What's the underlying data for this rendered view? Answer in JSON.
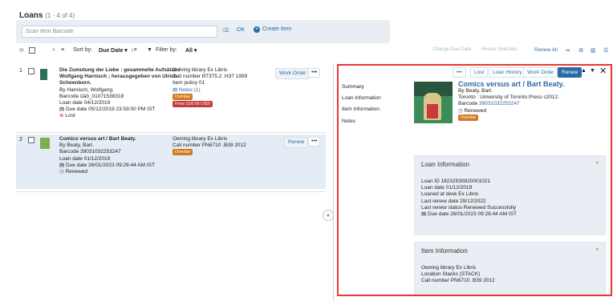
{
  "header": {
    "title": "Loans",
    "count": "(1 - 4 of 4)"
  },
  "scan": {
    "placeholder": "Scan Item Barcode",
    "ok": "OK",
    "create_item": "Create Item"
  },
  "toolbar": {
    "sort_label": "Sort by:",
    "sort_value": "Due Date",
    "filter_label": "Filter by:",
    "filter_value": "All",
    "change_due_date": "Change Due Date",
    "renew_selected": "Renew Selected",
    "renew_all": "Renew All"
  },
  "loans": [
    {
      "num": "1",
      "title": "Die Zumutung der Liebe : gesammelte Aufsätze / Wolfgang Harnisch ; herausgegeben von Ulrich Schoenborn.",
      "by": "By Harnisch, Wolfgang.",
      "barcode": "Barcode üäö_01071538318",
      "loan_date": "Loan date 04/12/2019",
      "due_date": "Due date 05/12/2019 23:59:00 PM IST",
      "status": "Lost",
      "owning_library": "Owning library Ex Libris",
      "call_number": "Call number BT375.2 .H37 1999",
      "item_policy": "Item policy 01",
      "notes": "Notes (1)",
      "badge_overdue": "Overdue",
      "badge_fines": "Fines (100.00 USD)",
      "action": "Work Order",
      "more": "•••"
    },
    {
      "num": "2",
      "title": "Comics versus art / Bart Beaty.",
      "by": "By Beaty, Bart.",
      "barcode": "Barcode 39031032253247",
      "loan_date": "Loan date 01/12/2019",
      "due_date": "Due date 26/01/2023 09:26:44 AM IST",
      "status": "Renewed",
      "owning_library": "Owning library Ex Libris",
      "call_number": "Call number PN6710 .B39 2012",
      "badge_overdue": "Overdue",
      "action": "Renew",
      "more": "•••"
    }
  ],
  "panel": {
    "more": "•••",
    "lost": "Lost",
    "loan_history": "Loan History",
    "work_order": "Work Order",
    "renew": "Renew",
    "nav": [
      "Summary",
      "Loan Information",
      "Item Information",
      "Notes"
    ],
    "title": "Comics versus art / Bart Beaty.",
    "by": "By Beaty, Bart.",
    "publisher": "Toronto : University of Toronto Press c2012.",
    "barcode_label": "Barcode",
    "barcode_value": "39031032253247",
    "status": "Renewed",
    "badge": "Overdue",
    "loan_info": {
      "heading": "Loan Information",
      "loan_id": "Loan ID 18232930820001021",
      "loan_date": "Loan date 01/12/2019",
      "loaned_at": "Loaned at desk Ex Libris",
      "last_renew": "Last renew date 29/12/2022",
      "renew_status": "Last renew status Renewed Successfully",
      "due_date": "Due date 26/01/2023 09:26:44 AM IST"
    },
    "item_info": {
      "heading": "Item Information",
      "owning_library": "Owning library Ex Libris",
      "location": "Location Stacks (STACK)",
      "call_number": "Call number PN6710 .B39 2012"
    }
  }
}
